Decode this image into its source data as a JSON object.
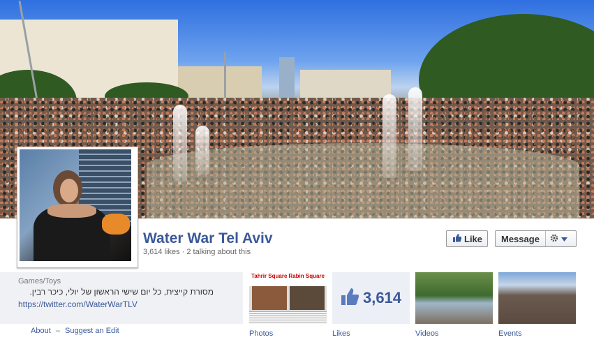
{
  "page": {
    "name": "Water War Tel Aviv",
    "stats": "3,614 likes · 2 talking about this",
    "category": "Games/Toys",
    "description": "מסורת קייצית, כל יום שישי הראשון של יולי, כיכר רבין.",
    "website": "https://twitter.com/WaterWarTLV"
  },
  "actions": {
    "like_label": "Like",
    "message_label": "Message",
    "gear_icon": "gear-icon",
    "dropdown_icon": "chevron-down-icon"
  },
  "footer_links": {
    "about": "About",
    "separator": "–",
    "suggest": "Suggest an Edit"
  },
  "apps": [
    {
      "label": "Photos",
      "left_text": "Tahrir Square",
      "right_text": "Rabin Square"
    },
    {
      "label": "Likes",
      "count": "3,614"
    },
    {
      "label": "Videos"
    },
    {
      "label": "Events"
    }
  ],
  "colors": {
    "brand": "#3b5998",
    "panel": "#f0f1f5"
  }
}
